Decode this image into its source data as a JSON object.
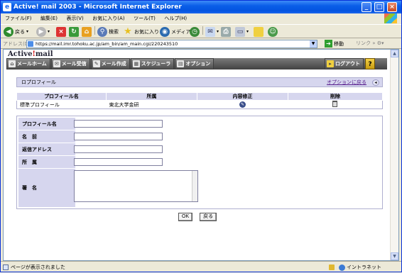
{
  "window": {
    "title": "Active! mail 2003 - Microsoft Internet Explorer",
    "icon": "ie-icon",
    "min": "_",
    "max": "□",
    "close": "×"
  },
  "menubar": [
    "ファイル(F)",
    "編集(E)",
    "表示(V)",
    "お気に入り(A)",
    "ツール(T)",
    "ヘルプ(H)"
  ],
  "toolbar": {
    "back": "戻る",
    "search": "検索",
    "favorites": "お気に入り",
    "media": "メディア"
  },
  "address": {
    "label": "アドレス(D)",
    "url": "https://mail.imr.tohoku.ac.jp/am_bin/am_main.cgi/220243510",
    "go": "移動",
    "links": "リンク"
  },
  "app": {
    "logo_left": "Active",
    "logo_slash": "!",
    "logo_right": "mail",
    "nav": [
      {
        "label": "メールホーム",
        "icon": "home-icon"
      },
      {
        "label": "メール受信",
        "icon": "inbox-icon"
      },
      {
        "label": "メール作成",
        "icon": "compose-icon"
      },
      {
        "label": "スケジューラ",
        "icon": "calendar-icon"
      },
      {
        "label": "オプション",
        "icon": "options-icon"
      }
    ],
    "logout": "ログアウト",
    "help": "?"
  },
  "section": {
    "title": "ロプロフィール",
    "back_link": "オプションに戻る",
    "back_icon": "◂"
  },
  "profiles_table": {
    "headers": [
      "プロフィール名",
      "所属",
      "内容修正",
      "削除"
    ],
    "rows": [
      {
        "name": "標準プロフィール",
        "affiliation": "東北大学金研"
      }
    ]
  },
  "form": {
    "fields": [
      {
        "label": "プロフィール名",
        "value": ""
      },
      {
        "label": "名　前",
        "value": ""
      },
      {
        "label": "返信アドレス",
        "value": ""
      },
      {
        "label": "所　属",
        "value": ""
      },
      {
        "label": "署　名",
        "value": ""
      }
    ]
  },
  "buttons": {
    "ok": "OK",
    "back": "戻る"
  },
  "status": {
    "text": "ページが表示されました",
    "zone": "イントラネット"
  }
}
